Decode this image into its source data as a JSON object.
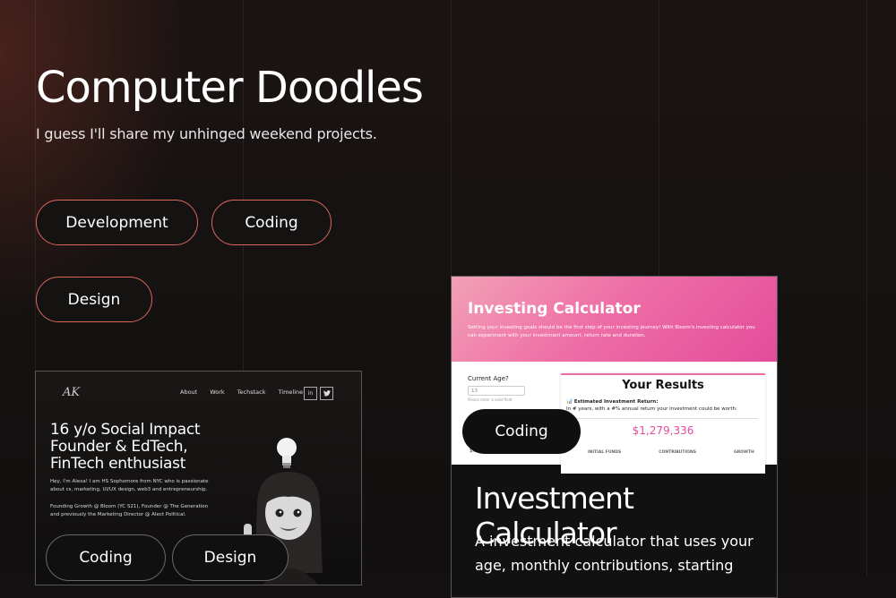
{
  "header": {
    "title": "Computer Doodles",
    "subtitle": "I guess I'll share my unhinged weekend projects."
  },
  "filters": [
    "Development",
    "Coding",
    "Design"
  ],
  "project1": {
    "preview": {
      "logo": "AK",
      "nav": [
        "About",
        "Work",
        "Techstack",
        "Timeline"
      ],
      "social": [
        "in",
        "tw"
      ],
      "headline": "16 y/o Social Impact Founder & EdTech, FinTech enthusiast",
      "bio": "Hey, I'm Alexa! I am HS Sophomore from NYC who is passionate about cs, marketing, UI/UX design, web3 and entrepreneurship.",
      "roles": "Founding Growth @ Bloom (YC S21), Founder @ The Generation and previously the Marketing Director @ Alect Political."
    },
    "tags": [
      "Coding",
      "Design"
    ]
  },
  "project2": {
    "preview": {
      "header_title": "Investing Calculator",
      "header_desc": "Setting your investing goals should be the first step of your investing journey! With Bloom's investing calculator you can experiment with your investment amount, return rate and duration.",
      "age_label": "Current Age?",
      "age_value": "13",
      "age_hint": "Please enter a valid field",
      "zero_value": "$0",
      "results_title": "Your Results",
      "estimated_label": "📊 Estimated Investment Return:",
      "estimated_desc": "In # years, with a #% annual return your investment could be worth:",
      "amount": "$1,279,336",
      "columns": [
        "INITIAL FUNDS",
        "CONTRIBUTIONS",
        "GROWTH"
      ]
    },
    "tag": "Coding",
    "title": "Investment Calculator",
    "description": "A investment calculator that uses your age, monthly contributions, starting"
  }
}
